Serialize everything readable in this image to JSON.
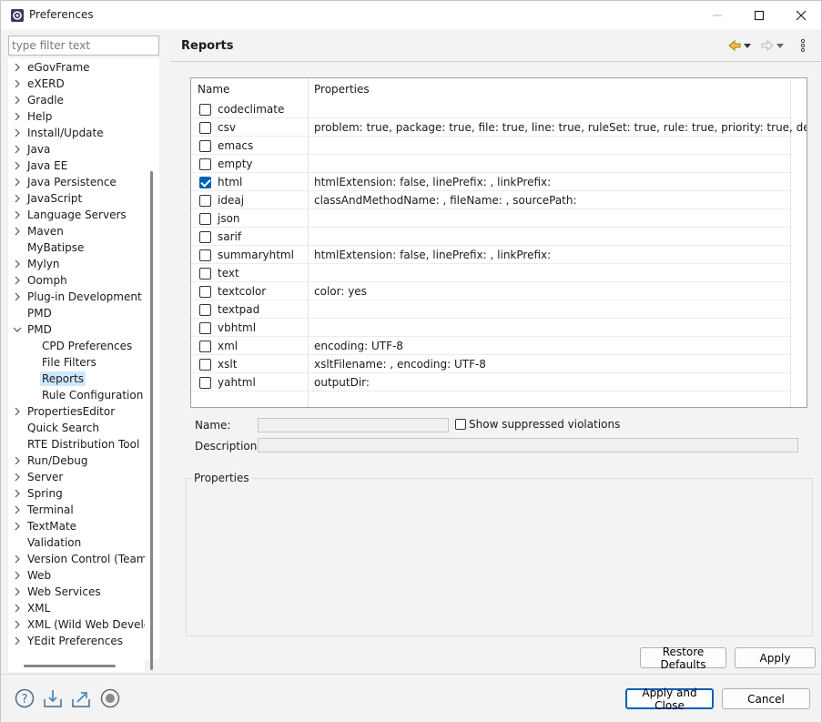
{
  "window": {
    "title": "Preferences"
  },
  "filter": {
    "placeholder": "type filter text"
  },
  "tree": [
    {
      "label": "eGovFrame",
      "expandable": true,
      "level": 0
    },
    {
      "label": "eXERD",
      "expandable": true,
      "level": 0
    },
    {
      "label": "Gradle",
      "expandable": true,
      "level": 0
    },
    {
      "label": "Help",
      "expandable": true,
      "level": 0
    },
    {
      "label": "Install/Update",
      "expandable": true,
      "level": 0
    },
    {
      "label": "Java",
      "expandable": true,
      "level": 0
    },
    {
      "label": "Java EE",
      "expandable": true,
      "level": 0
    },
    {
      "label": "Java Persistence",
      "expandable": true,
      "level": 0
    },
    {
      "label": "JavaScript",
      "expandable": true,
      "level": 0
    },
    {
      "label": "Language Servers",
      "expandable": true,
      "level": 0
    },
    {
      "label": "Maven",
      "expandable": true,
      "level": 0
    },
    {
      "label": "MyBatipse",
      "expandable": false,
      "level": 0
    },
    {
      "label": "Mylyn",
      "expandable": true,
      "level": 0
    },
    {
      "label": "Oomph",
      "expandable": true,
      "level": 0
    },
    {
      "label": "Plug-in Development",
      "expandable": true,
      "level": 0
    },
    {
      "label": "PMD",
      "expandable": false,
      "level": 0
    },
    {
      "label": "PMD",
      "expandable": true,
      "expanded": true,
      "level": 0
    },
    {
      "label": "CPD Preferences",
      "expandable": false,
      "level": 1
    },
    {
      "label": "File Filters",
      "expandable": false,
      "level": 1
    },
    {
      "label": "Reports",
      "expandable": false,
      "level": 1,
      "selected": true
    },
    {
      "label": "Rule Configuration",
      "expandable": false,
      "level": 1
    },
    {
      "label": "PropertiesEditor",
      "expandable": true,
      "level": 0
    },
    {
      "label": "Quick Search",
      "expandable": false,
      "level": 0
    },
    {
      "label": "RTE Distribution Tool",
      "expandable": false,
      "level": 0
    },
    {
      "label": "Run/Debug",
      "expandable": true,
      "level": 0
    },
    {
      "label": "Server",
      "expandable": true,
      "level": 0
    },
    {
      "label": "Spring",
      "expandable": true,
      "level": 0
    },
    {
      "label": "Terminal",
      "expandable": true,
      "level": 0
    },
    {
      "label": "TextMate",
      "expandable": true,
      "level": 0
    },
    {
      "label": "Validation",
      "expandable": false,
      "level": 0
    },
    {
      "label": "Version Control (Team)",
      "expandable": true,
      "level": 0
    },
    {
      "label": "Web",
      "expandable": true,
      "level": 0
    },
    {
      "label": "Web Services",
      "expandable": true,
      "level": 0
    },
    {
      "label": "XML",
      "expandable": true,
      "level": 0
    },
    {
      "label": "XML (Wild Web Develop",
      "expandable": true,
      "level": 0
    },
    {
      "label": "YEdit Preferences",
      "expandable": true,
      "level": 0
    }
  ],
  "page": {
    "title": "Reports",
    "table": {
      "headers": [
        "Name",
        "Properties"
      ],
      "rows": [
        {
          "name": "codeclimate",
          "props": "",
          "checked": false
        },
        {
          "name": "csv",
          "props": "problem: true, package: true, file: true, line: true, ruleSet: true, rule: true, priority: true, desc: true",
          "checked": false
        },
        {
          "name": "emacs",
          "props": "",
          "checked": false
        },
        {
          "name": "empty",
          "props": "",
          "checked": false
        },
        {
          "name": "html",
          "props": "htmlExtension: false, linePrefix: , linkPrefix:",
          "checked": true
        },
        {
          "name": "ideaj",
          "props": "classAndMethodName: , fileName: , sourcePath:",
          "checked": false
        },
        {
          "name": "json",
          "props": "",
          "checked": false
        },
        {
          "name": "sarif",
          "props": "",
          "checked": false
        },
        {
          "name": "summaryhtml",
          "props": "htmlExtension: false, linePrefix: , linkPrefix:",
          "checked": false
        },
        {
          "name": "text",
          "props": "",
          "checked": false
        },
        {
          "name": "textcolor",
          "props": "color: yes",
          "checked": false
        },
        {
          "name": "textpad",
          "props": "",
          "checked": false
        },
        {
          "name": "vbhtml",
          "props": "",
          "checked": false
        },
        {
          "name": "xml",
          "props": "encoding: UTF-8",
          "checked": false
        },
        {
          "name": "xslt",
          "props": "xsltFilename: , encoding: UTF-8",
          "checked": false
        },
        {
          "name": "yahtml",
          "props": "outputDir:",
          "checked": false
        }
      ]
    },
    "name_label": "Name:",
    "description_label": "Description:",
    "show_suppressed_label": "Show suppressed violations",
    "properties_group": "Properties",
    "restore_defaults": "Restore Defaults",
    "apply": "Apply"
  },
  "footer": {
    "apply_close": "Apply and Close",
    "cancel": "Cancel"
  },
  "colors": {
    "accent": "#005fb8",
    "selection": "#cde8ff",
    "nav_arrow": "#e8a317"
  }
}
